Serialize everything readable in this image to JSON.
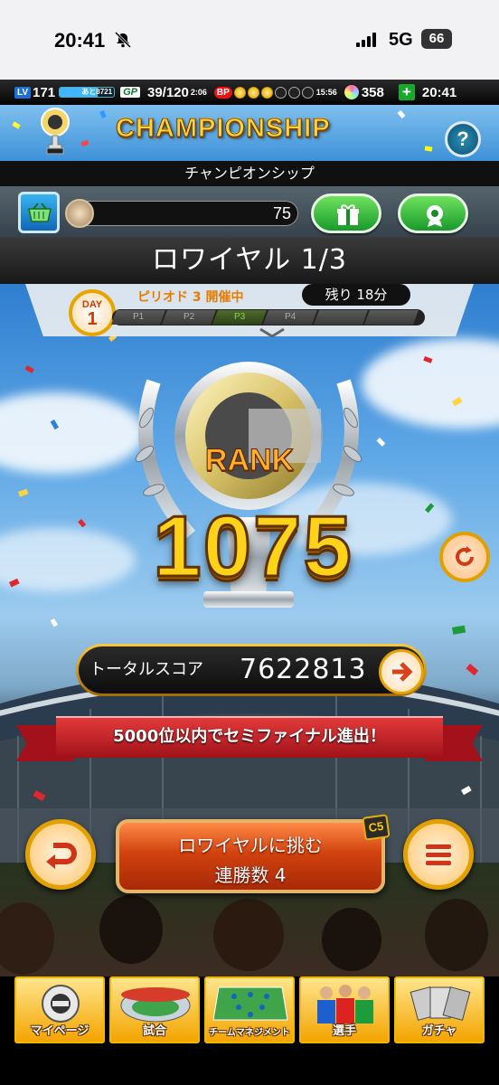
{
  "status_bar": {
    "time": "20:41",
    "network": "5G",
    "battery": "66"
  },
  "hud": {
    "level_tag": "LV",
    "level": "171",
    "exp_text": "あと8721",
    "exp_progress": 0.7,
    "gp_tag": "GP",
    "gp": "39/120",
    "gp_time": "2:06",
    "bp_tag": "BP",
    "bp_filled": 3,
    "bp_total": 6,
    "bp_time": "15:56",
    "gems": "358",
    "add": "+",
    "clock": "20:41"
  },
  "banner": {
    "title": "CHAMPIONSHIP",
    "help": "?"
  },
  "subtitle": "チャンピオンシップ",
  "currency": {
    "medals": "75"
  },
  "league": {
    "title": "ロワイヤル 1/3"
  },
  "period": {
    "day_label": "DAY",
    "day_num": "1",
    "status": "ピリオド 3 開催中",
    "remaining": "残り 18分",
    "segments": [
      "P1",
      "P2",
      "P3",
      "P4",
      "",
      ""
    ],
    "active_index": 2
  },
  "rank": {
    "word": "RANK",
    "value": "1075"
  },
  "score": {
    "label": "トータルスコア",
    "value": "7622813"
  },
  "ribbon": {
    "text": "5000位以内でセミファイナル進出！"
  },
  "challenge": {
    "line1": "ロワイヤルに挑む",
    "line2": "連勝数 4",
    "badge": "C5"
  },
  "nav": [
    {
      "label": "マイページ"
    },
    {
      "label": "試合"
    },
    {
      "label": "チームマネジメント"
    },
    {
      "label": "選手"
    },
    {
      "label": "ガチャ"
    }
  ],
  "colors": {
    "gold": "#ffd21a",
    "accent_green": "#189a2c",
    "ribbon_red": "#c81e26"
  }
}
